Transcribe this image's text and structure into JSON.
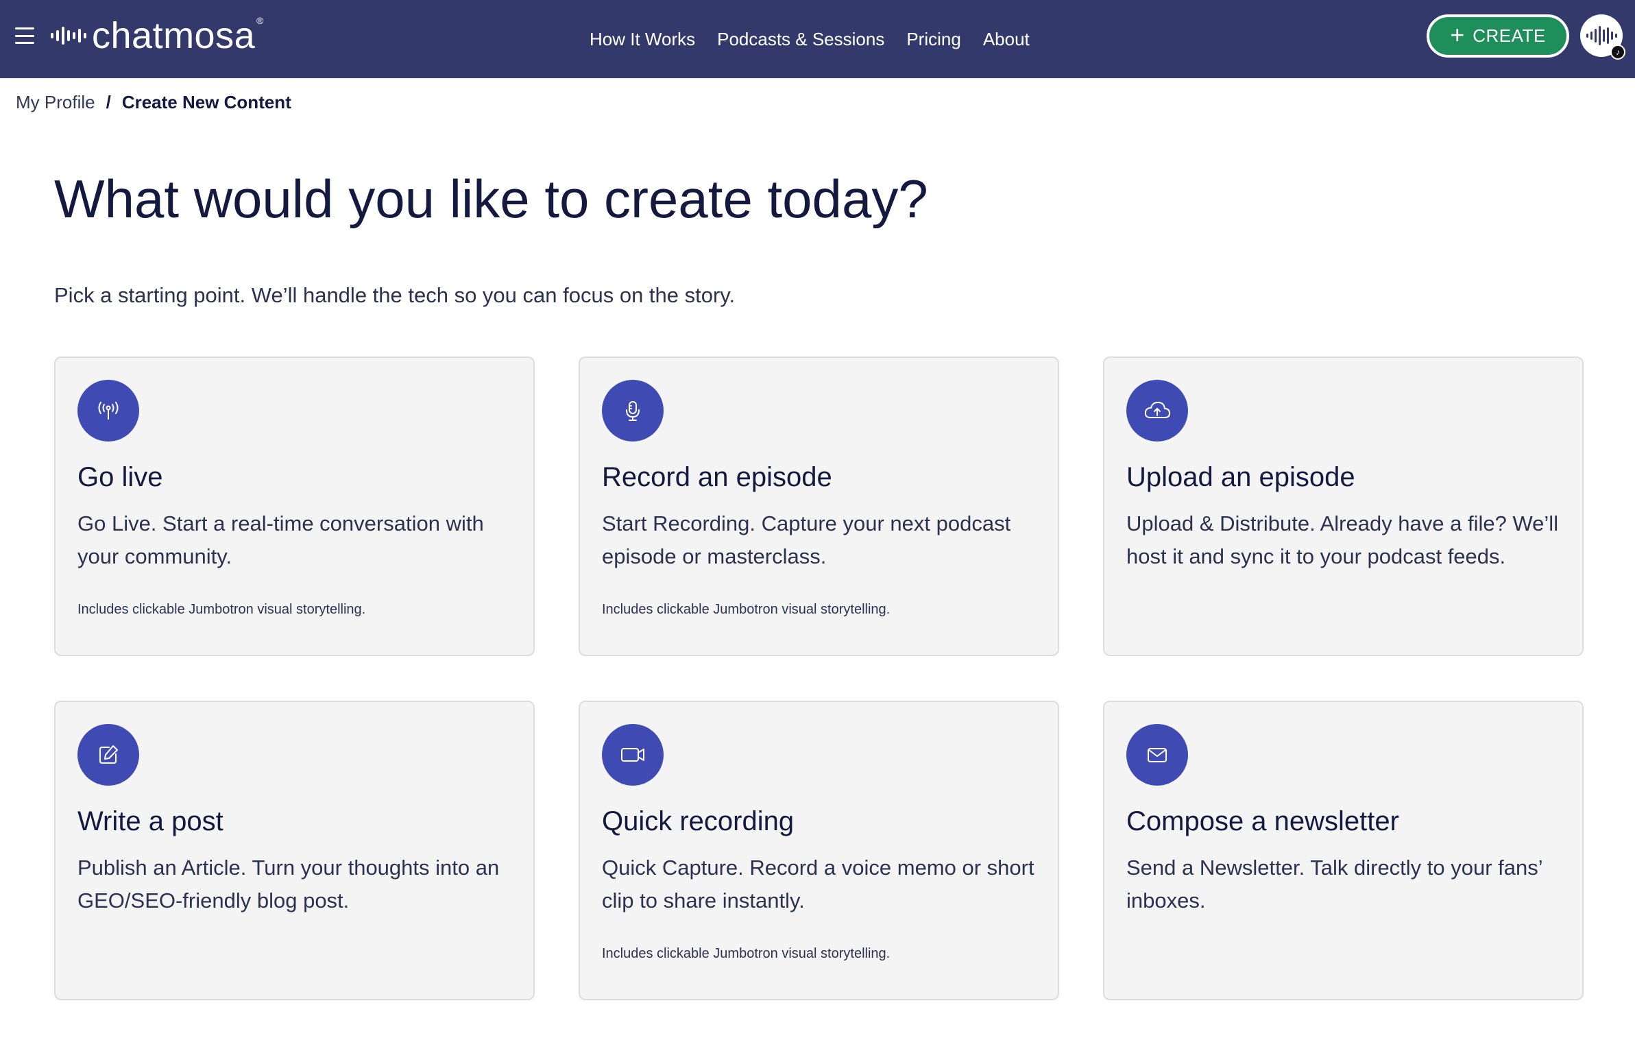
{
  "brand": {
    "name": "chatmosa",
    "reg": "®"
  },
  "nav": {
    "links": [
      "How It Works",
      "Podcasts & Sessions",
      "Pricing",
      "About"
    ],
    "create_label": "CREATE"
  },
  "breadcrumb": {
    "parent": "My Profile",
    "separator": "/",
    "current": "Create New Content"
  },
  "page": {
    "title": "What would you like to create today?",
    "subtitle": "Pick a starting point. We’ll handle the tech so you can focus on the story."
  },
  "cards": [
    {
      "icon": "broadcast-antenna-icon",
      "title": "Go live",
      "desc": "Go Live. Start a real-time conversation with your community.",
      "note": "Includes clickable Jumbotron visual storytelling."
    },
    {
      "icon": "microphone-icon",
      "title": "Record an episode",
      "desc": "Start Recording. Capture your next podcast episode or masterclass.",
      "note": "Includes clickable Jumbotron visual storytelling."
    },
    {
      "icon": "cloud-upload-icon",
      "title": "Upload an episode",
      "desc": "Upload & Distribute. Already have a file? We’ll host it and sync it to your podcast feeds.",
      "note": ""
    },
    {
      "icon": "edit-pencil-icon",
      "title": "Write a post",
      "desc": "Publish an Article. Turn your thoughts into an GEO/SEO-friendly blog post.",
      "note": ""
    },
    {
      "icon": "video-camera-icon",
      "title": "Quick recording",
      "desc": "Quick Capture. Record a voice memo or short clip to share instantly.",
      "note": "Includes clickable Jumbotron visual storytelling."
    },
    {
      "icon": "envelope-icon",
      "title": "Compose a newsletter",
      "desc": "Send a Newsletter. Talk directly to your fans’ inboxes.",
      "note": ""
    }
  ],
  "colors": {
    "navbar": "#33396b",
    "create_button": "#1e8f5a",
    "icon_circle": "#3f4bb3",
    "card_bg": "#f4f4f5",
    "text_dark": "#14193f"
  }
}
